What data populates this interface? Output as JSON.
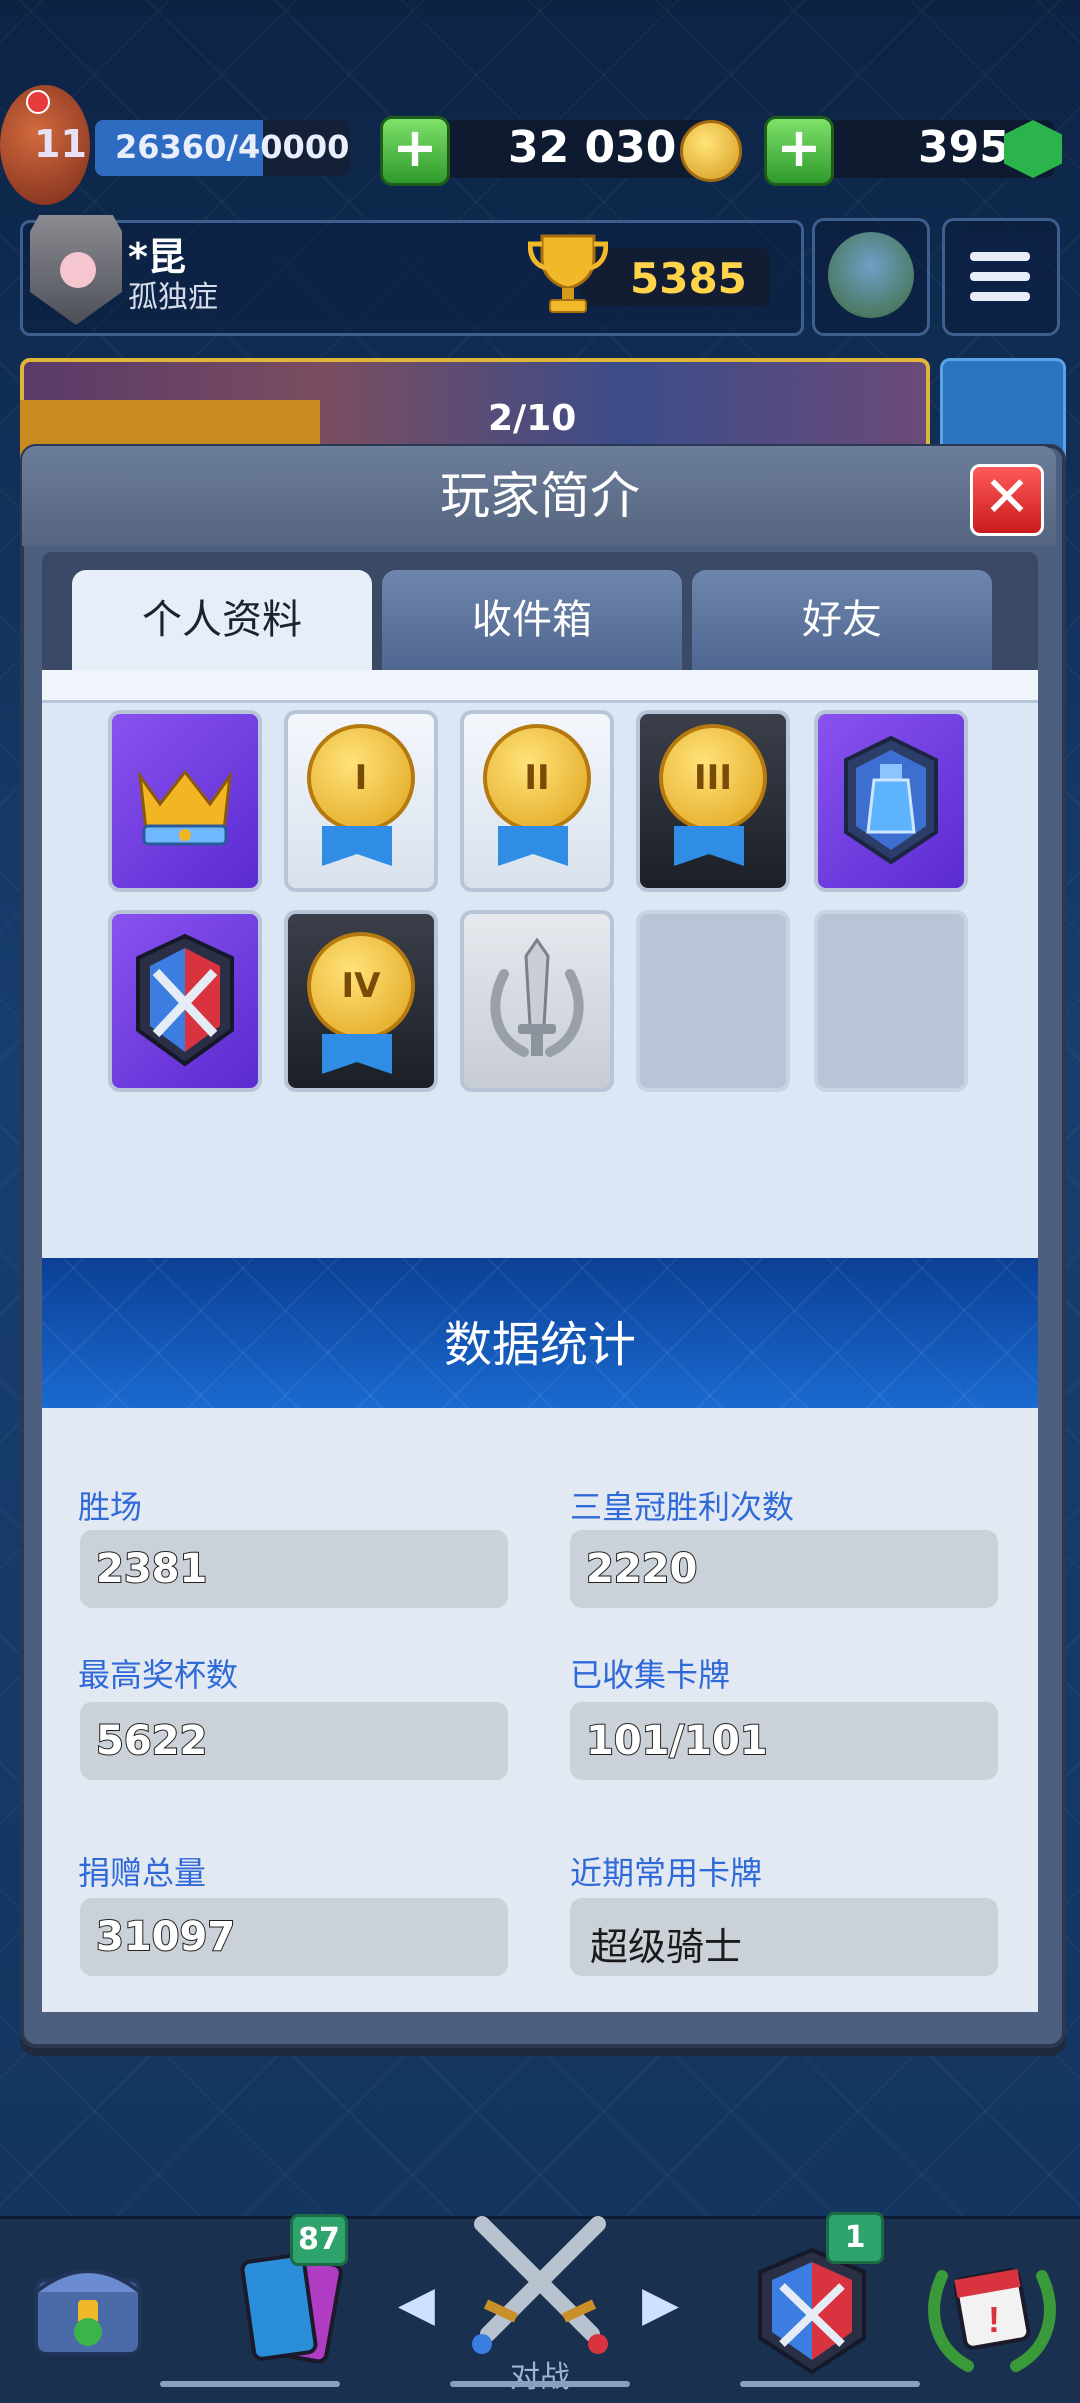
{
  "top_bar": {
    "level": "11",
    "xp": "26360/40000",
    "xp_progress": 0.659,
    "gold": "32 030",
    "gems": "395",
    "plus_symbol": "+"
  },
  "profile": {
    "name": "*昆",
    "clan": "孤独症",
    "trophies": "5385"
  },
  "banner": {
    "progress": "2/10"
  },
  "modal": {
    "title": "玩家简介",
    "close_symbol": "✕",
    "tabs": [
      {
        "label": "个人资料",
        "active": true
      },
      {
        "label": "收件箱",
        "active": false
      },
      {
        "label": "好友",
        "active": false
      }
    ],
    "badges": [
      {
        "icon": "crown-badge-icon",
        "style": "purple"
      },
      {
        "icon": "medal-icon",
        "numeral": "I",
        "style": "white"
      },
      {
        "icon": "medal-icon",
        "numeral": "II",
        "style": "white"
      },
      {
        "icon": "medal-icon",
        "numeral": "III",
        "style": "dark"
      },
      {
        "icon": "elixir-badge-icon",
        "style": "purple"
      },
      {
        "icon": "crossed-swords-shield-icon",
        "style": "purple"
      },
      {
        "icon": "medal-icon",
        "numeral": "IV",
        "style": "dark"
      },
      {
        "icon": "sword-laurel-icon",
        "style": "gray"
      },
      {
        "icon": "",
        "style": "empty"
      },
      {
        "icon": "",
        "style": "empty"
      }
    ],
    "stats_title": "数据统计",
    "stats": [
      {
        "label": "胜场",
        "value": "2381"
      },
      {
        "label": "三皇冠胜利次数",
        "value": "2220"
      },
      {
        "label": "最高奖杯数",
        "value": "5622"
      },
      {
        "label": "已收集卡牌",
        "value": "101/101"
      },
      {
        "label": "捐赠总量",
        "value": "31097"
      },
      {
        "label": "近期常用卡牌",
        "value": "超级骑士"
      }
    ]
  },
  "bottom_nav": {
    "cards_badge": "87",
    "clan_badge": "1",
    "battle_label": "对战",
    "left_arrow": "◀",
    "right_arrow": "▶"
  },
  "colors": {
    "accent_blue": "#2f6ad8",
    "trophy_gold": "#ffd34a",
    "close_red": "#c91b1b"
  }
}
